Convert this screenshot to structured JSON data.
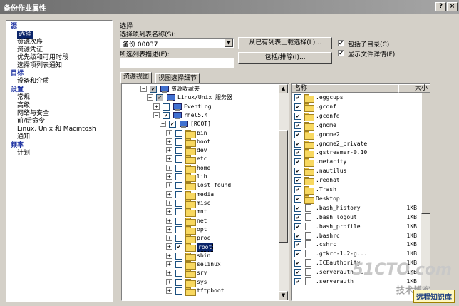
{
  "window": {
    "title": "备份作业属性"
  },
  "title_buttons": {
    "help": "?",
    "close": "×"
  },
  "nav": {
    "items": [
      {
        "label": "源",
        "kind": "head"
      },
      {
        "label": "选择",
        "kind": "selected"
      },
      {
        "label": "资源次序",
        "kind": "item"
      },
      {
        "label": "资源凭证",
        "kind": "item"
      },
      {
        "label": "优先级和可用时段",
        "kind": "item"
      },
      {
        "label": "选择项列表通知",
        "kind": "item"
      },
      {
        "label": "目标",
        "kind": "head"
      },
      {
        "label": "设备和介质",
        "kind": "item"
      },
      {
        "label": "设置",
        "kind": "head"
      },
      {
        "label": "常规",
        "kind": "item"
      },
      {
        "label": "高级",
        "kind": "item"
      },
      {
        "label": "网络与安全",
        "kind": "item"
      },
      {
        "label": "前/后命令",
        "kind": "item"
      },
      {
        "label": "Linux, Unix 和 Macintosh",
        "kind": "item"
      },
      {
        "label": "通知",
        "kind": "item"
      },
      {
        "label": "频率",
        "kind": "head"
      },
      {
        "label": "计划",
        "kind": "item"
      }
    ]
  },
  "selection": {
    "section_title": "选择",
    "list_name_label": "选择项列表名称(S):",
    "list_name_value": "备份 00037",
    "desc_label": "所选列表描述(E):",
    "desc_value": "",
    "load_button": "从已有列表上载选择(L)...",
    "include_button": "包括/排除(I)...",
    "include_subdirs": "包括子目录(C)",
    "show_details": "显示文件详情(F)"
  },
  "tabs": [
    {
      "label": "资源视图",
      "active": true
    },
    {
      "label": "视图选择细节",
      "active": false
    }
  ],
  "tree": [
    {
      "label": "资源收藏夹",
      "indent": 2,
      "expander": "-",
      "check": "gray",
      "icon": "pc"
    },
    {
      "label": "Linux/Unix 服务器",
      "indent": 3,
      "expander": "-",
      "check": "gray",
      "icon": "pc"
    },
    {
      "label": "EventLog",
      "indent": 4,
      "expander": "+",
      "check": "none",
      "icon": "pc"
    },
    {
      "label": "rhel5.4",
      "indent": 4,
      "expander": "-",
      "check": "checked",
      "icon": "pc"
    },
    {
      "label": "[ROOT]",
      "indent": 5,
      "expander": "-",
      "check": "checked",
      "icon": "pc"
    },
    {
      "label": "bin",
      "indent": 6,
      "expander": "+",
      "check": "none",
      "icon": "folder"
    },
    {
      "label": "boot",
      "indent": 6,
      "expander": "+",
      "check": "none",
      "icon": "folder"
    },
    {
      "label": "dev",
      "indent": 6,
      "expander": "+",
      "check": "none",
      "icon": "folder"
    },
    {
      "label": "etc",
      "indent": 6,
      "expander": "+",
      "check": "none",
      "icon": "folder"
    },
    {
      "label": "home",
      "indent": 6,
      "expander": "+",
      "check": "none",
      "icon": "folder"
    },
    {
      "label": "lib",
      "indent": 6,
      "expander": "+",
      "check": "none",
      "icon": "folder"
    },
    {
      "label": "lost+found",
      "indent": 6,
      "expander": "+",
      "check": "none",
      "icon": "folder"
    },
    {
      "label": "media",
      "indent": 6,
      "expander": "+",
      "check": "none",
      "icon": "folder"
    },
    {
      "label": "misc",
      "indent": 6,
      "expander": "+",
      "check": "none",
      "icon": "folder"
    },
    {
      "label": "mnt",
      "indent": 6,
      "expander": "+",
      "check": "none",
      "icon": "folder"
    },
    {
      "label": "net",
      "indent": 6,
      "expander": "+",
      "check": "none",
      "icon": "folder"
    },
    {
      "label": "opt",
      "indent": 6,
      "expander": "+",
      "check": "none",
      "icon": "folder"
    },
    {
      "label": "proc",
      "indent": 6,
      "expander": "+",
      "check": "none",
      "icon": "folder"
    },
    {
      "label": "root",
      "indent": 6,
      "expander": "+",
      "check": "checked",
      "icon": "folder",
      "selected": true
    },
    {
      "label": "sbin",
      "indent": 6,
      "expander": "+",
      "check": "none",
      "icon": "folder"
    },
    {
      "label": "selinux",
      "indent": 6,
      "expander": "+",
      "check": "none",
      "icon": "folder"
    },
    {
      "label": "srv",
      "indent": 6,
      "expander": "+",
      "check": "none",
      "icon": "folder"
    },
    {
      "label": "sys",
      "indent": 6,
      "expander": "+",
      "check": "none",
      "icon": "folder"
    },
    {
      "label": "tftpboot",
      "indent": 6,
      "expander": "+",
      "check": "none",
      "icon": "folder"
    }
  ],
  "files": {
    "col_name": "名称",
    "col_size": "大小",
    "rows": [
      {
        "name": ".eggcups",
        "size": "",
        "type": "folder"
      },
      {
        "name": ".gconf",
        "size": "",
        "type": "folder"
      },
      {
        "name": ".gconfd",
        "size": "",
        "type": "folder"
      },
      {
        "name": ".gnome",
        "size": "",
        "type": "folder"
      },
      {
        "name": ".gnome2",
        "size": "",
        "type": "folder"
      },
      {
        "name": ".gnome2_private",
        "size": "",
        "type": "folder"
      },
      {
        "name": ".gstreamer-0.10",
        "size": "",
        "type": "folder"
      },
      {
        "name": ".metacity",
        "size": "",
        "type": "folder"
      },
      {
        "name": ".nautilus",
        "size": "",
        "type": "folder"
      },
      {
        "name": ".redhat",
        "size": "",
        "type": "folder"
      },
      {
        "name": ".Trash",
        "size": "",
        "type": "folder"
      },
      {
        "name": "Desktop",
        "size": "",
        "type": "folder"
      },
      {
        "name": ".bash_history",
        "size": "1KB",
        "type": "file"
      },
      {
        "name": ".bash_logout",
        "size": "1KB",
        "type": "file"
      },
      {
        "name": ".bash_profile",
        "size": "1KB",
        "type": "file"
      },
      {
        "name": ".bashrc",
        "size": "1KB",
        "type": "file"
      },
      {
        "name": ".cshrc",
        "size": "1KB",
        "type": "file"
      },
      {
        "name": ".gtkrc-1.2-g...",
        "size": "1KB",
        "type": "file"
      },
      {
        "name": ".ICEauthority",
        "size": "1KB",
        "type": "file"
      },
      {
        "name": ".serverauth....",
        "size": "1KB",
        "type": "file"
      },
      {
        "name": ".serverauth",
        "size": "1KB",
        "type": "file"
      }
    ]
  },
  "watermark": {
    "big": "51CTO.com",
    "sub": "技术博客",
    "badge": "远程知识库"
  }
}
